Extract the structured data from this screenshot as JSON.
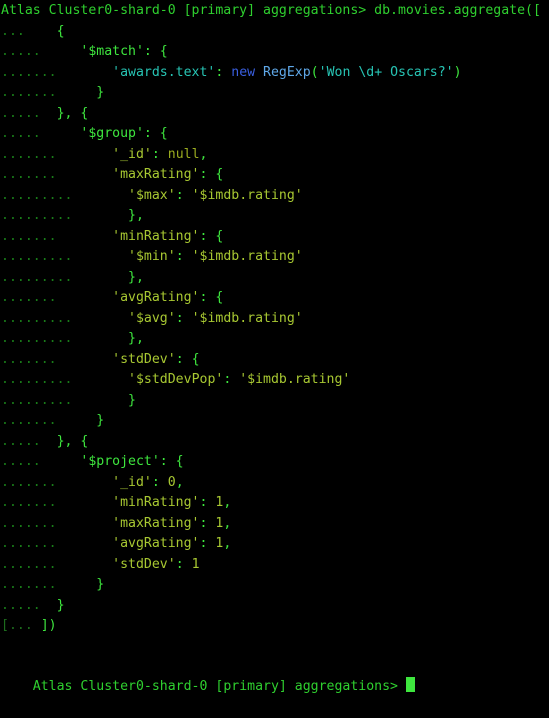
{
  "terminal": {
    "app": "mongosh",
    "background_color": "#000000",
    "prompt_text": "Atlas Cluster0-shard-0 [primary] aggregations> ",
    "prompt_color": "#2fd02f",
    "cursor_color": "#3ee63e",
    "command": "db.movies.aggregate([",
    "continuation_marker_3": "... ",
    "continuation_marker_5": "..... ",
    "continuation_marker_7": "....... ",
    "continuation_marker_9": "......... ",
    "continuation_close": "[... ",
    "lines": [
      {
        "id": "line-1-prompt",
        "segments": [
          {
            "text": "Atlas Cluster0-shard-0 [primary] aggregations> ",
            "role": "prompt"
          },
          {
            "text": "db.movies.aggregate([",
            "role": "cmd"
          }
        ]
      },
      {
        "id": "line-2",
        "segments": [
          {
            "text": "...  ",
            "role": "dots"
          },
          {
            "text": "  {",
            "role": "punct"
          }
        ]
      },
      {
        "id": "line-3",
        "segments": [
          {
            "text": ".....",
            "role": "dots"
          },
          {
            "text": "     '$match': {",
            "role": "key-green"
          }
        ]
      },
      {
        "id": "line-4",
        "segments": [
          {
            "text": ".......",
            "role": "dots"
          },
          {
            "text": "       ",
            "role": "punct"
          },
          {
            "text": "'awards.text'",
            "role": "key-cyan"
          },
          {
            "text": ": ",
            "role": "punct"
          },
          {
            "text": "new ",
            "role": "kw-blue"
          },
          {
            "text": "RegExp",
            "role": "cls-blue"
          },
          {
            "text": "(",
            "role": "key-green"
          },
          {
            "text": "'Won \\d+ Oscars?'",
            "role": "str-cyan"
          },
          {
            "text": ")",
            "role": "key-green"
          }
        ]
      },
      {
        "id": "line-5",
        "segments": [
          {
            "text": ".......",
            "role": "dots"
          },
          {
            "text": "     }",
            "role": "punct"
          }
        ]
      },
      {
        "id": "line-6",
        "segments": [
          {
            "text": ".....",
            "role": "dots"
          },
          {
            "text": "  }, {",
            "role": "punct"
          }
        ]
      },
      {
        "id": "line-7",
        "segments": [
          {
            "text": ".....",
            "role": "dots"
          },
          {
            "text": "     '$group': {",
            "role": "key-green"
          }
        ]
      },
      {
        "id": "line-8",
        "segments": [
          {
            "text": ".......",
            "role": "dots"
          },
          {
            "text": "       ",
            "role": "punct"
          },
          {
            "text": "'_id'",
            "role": "key-olive"
          },
          {
            "text": ": ",
            "role": "punct"
          },
          {
            "text": "null",
            "role": "val-olive"
          },
          {
            "text": ",",
            "role": "punct"
          }
        ]
      },
      {
        "id": "line-9",
        "segments": [
          {
            "text": ".......",
            "role": "dots"
          },
          {
            "text": "       ",
            "role": "punct"
          },
          {
            "text": "'maxRating'",
            "role": "key-olive"
          },
          {
            "text": ": ",
            "role": "punct"
          },
          {
            "text": "{",
            "role": "key-green"
          }
        ]
      },
      {
        "id": "line-10",
        "segments": [
          {
            "text": ".........",
            "role": "dots"
          },
          {
            "text": "       ",
            "role": "punct"
          },
          {
            "text": "'$max'",
            "role": "key-olive"
          },
          {
            "text": ": ",
            "role": "punct"
          },
          {
            "text": "'$imdb.rating'",
            "role": "key-olive"
          }
        ]
      },
      {
        "id": "line-11",
        "segments": [
          {
            "text": ".........",
            "role": "dots"
          },
          {
            "text": "       },",
            "role": "punct"
          }
        ]
      },
      {
        "id": "line-12",
        "segments": [
          {
            "text": ".......",
            "role": "dots"
          },
          {
            "text": "       ",
            "role": "punct"
          },
          {
            "text": "'minRating'",
            "role": "key-olive"
          },
          {
            "text": ": ",
            "role": "punct"
          },
          {
            "text": "{",
            "role": "key-green"
          }
        ]
      },
      {
        "id": "line-13",
        "segments": [
          {
            "text": ".........",
            "role": "dots"
          },
          {
            "text": "       ",
            "role": "punct"
          },
          {
            "text": "'$min'",
            "role": "key-olive"
          },
          {
            "text": ": ",
            "role": "punct"
          },
          {
            "text": "'$imdb.rating'",
            "role": "key-olive"
          }
        ]
      },
      {
        "id": "line-14",
        "segments": [
          {
            "text": ".........",
            "role": "dots"
          },
          {
            "text": "       },",
            "role": "punct"
          }
        ]
      },
      {
        "id": "line-15",
        "segments": [
          {
            "text": ".......",
            "role": "dots"
          },
          {
            "text": "       ",
            "role": "punct"
          },
          {
            "text": "'avgRating'",
            "role": "key-olive"
          },
          {
            "text": ": ",
            "role": "punct"
          },
          {
            "text": "{",
            "role": "key-green"
          }
        ]
      },
      {
        "id": "line-16",
        "segments": [
          {
            "text": ".........",
            "role": "dots"
          },
          {
            "text": "       ",
            "role": "punct"
          },
          {
            "text": "'$avg'",
            "role": "key-olive"
          },
          {
            "text": ": ",
            "role": "punct"
          },
          {
            "text": "'$imdb.rating'",
            "role": "key-olive"
          }
        ]
      },
      {
        "id": "line-17",
        "segments": [
          {
            "text": ".........",
            "role": "dots"
          },
          {
            "text": "       },",
            "role": "punct"
          }
        ]
      },
      {
        "id": "line-18",
        "segments": [
          {
            "text": ".......",
            "role": "dots"
          },
          {
            "text": "       ",
            "role": "punct"
          },
          {
            "text": "'stdDev'",
            "role": "key-olive"
          },
          {
            "text": ": ",
            "role": "punct"
          },
          {
            "text": "{",
            "role": "key-green"
          }
        ]
      },
      {
        "id": "line-19",
        "segments": [
          {
            "text": ".........",
            "role": "dots"
          },
          {
            "text": "       ",
            "role": "punct"
          },
          {
            "text": "'$stdDevPop'",
            "role": "key-olive"
          },
          {
            "text": ": ",
            "role": "punct"
          },
          {
            "text": "'$imdb.rating'",
            "role": "key-olive"
          }
        ]
      },
      {
        "id": "line-20",
        "segments": [
          {
            "text": ".........",
            "role": "dots"
          },
          {
            "text": "       }",
            "role": "punct"
          }
        ]
      },
      {
        "id": "line-21",
        "segments": [
          {
            "text": ".......",
            "role": "dots"
          },
          {
            "text": "     }",
            "role": "punct"
          }
        ]
      },
      {
        "id": "line-22",
        "segments": [
          {
            "text": ".....",
            "role": "dots"
          },
          {
            "text": "  }, {",
            "role": "punct"
          }
        ]
      },
      {
        "id": "line-23",
        "segments": [
          {
            "text": ".....",
            "role": "dots"
          },
          {
            "text": "     '$project': {",
            "role": "key-green"
          }
        ]
      },
      {
        "id": "line-24",
        "segments": [
          {
            "text": ".......",
            "role": "dots"
          },
          {
            "text": "       ",
            "role": "punct"
          },
          {
            "text": "'_id'",
            "role": "key-olive"
          },
          {
            "text": ": ",
            "role": "punct"
          },
          {
            "text": "0",
            "role": "num-olive"
          },
          {
            "text": ",",
            "role": "punct"
          }
        ]
      },
      {
        "id": "line-25",
        "segments": [
          {
            "text": ".......",
            "role": "dots"
          },
          {
            "text": "       ",
            "role": "punct"
          },
          {
            "text": "'minRating'",
            "role": "key-olive"
          },
          {
            "text": ": ",
            "role": "punct"
          },
          {
            "text": "1",
            "role": "num-olive"
          },
          {
            "text": ",",
            "role": "punct"
          }
        ]
      },
      {
        "id": "line-26",
        "segments": [
          {
            "text": ".......",
            "role": "dots"
          },
          {
            "text": "       ",
            "role": "punct"
          },
          {
            "text": "'maxRating'",
            "role": "key-olive"
          },
          {
            "text": ": ",
            "role": "punct"
          },
          {
            "text": "1",
            "role": "num-olive"
          },
          {
            "text": ",",
            "role": "punct"
          }
        ]
      },
      {
        "id": "line-27",
        "segments": [
          {
            "text": ".......",
            "role": "dots"
          },
          {
            "text": "       ",
            "role": "punct"
          },
          {
            "text": "'avgRating'",
            "role": "key-olive"
          },
          {
            "text": ": ",
            "role": "punct"
          },
          {
            "text": "1",
            "role": "num-olive"
          },
          {
            "text": ",",
            "role": "punct"
          }
        ]
      },
      {
        "id": "line-28",
        "segments": [
          {
            "text": ".......",
            "role": "dots"
          },
          {
            "text": "       ",
            "role": "punct"
          },
          {
            "text": "'stdDev'",
            "role": "key-olive"
          },
          {
            "text": ": ",
            "role": "punct"
          },
          {
            "text": "1",
            "role": "num-olive"
          }
        ]
      },
      {
        "id": "line-29",
        "segments": [
          {
            "text": ".......",
            "role": "dots"
          },
          {
            "text": "     }",
            "role": "punct"
          }
        ]
      },
      {
        "id": "line-30",
        "segments": [
          {
            "text": ".....",
            "role": "dots"
          },
          {
            "text": "  }",
            "role": "punct"
          }
        ]
      },
      {
        "id": "line-31",
        "segments": [
          {
            "text": "[... ",
            "role": "dim"
          },
          {
            "text": "])",
            "role": "punct"
          }
        ]
      }
    ],
    "final_prompt": {
      "id": "line-final-prompt",
      "text": "Atlas Cluster0-shard-0 [primary] aggregations> ",
      "cursor": "█"
    }
  }
}
